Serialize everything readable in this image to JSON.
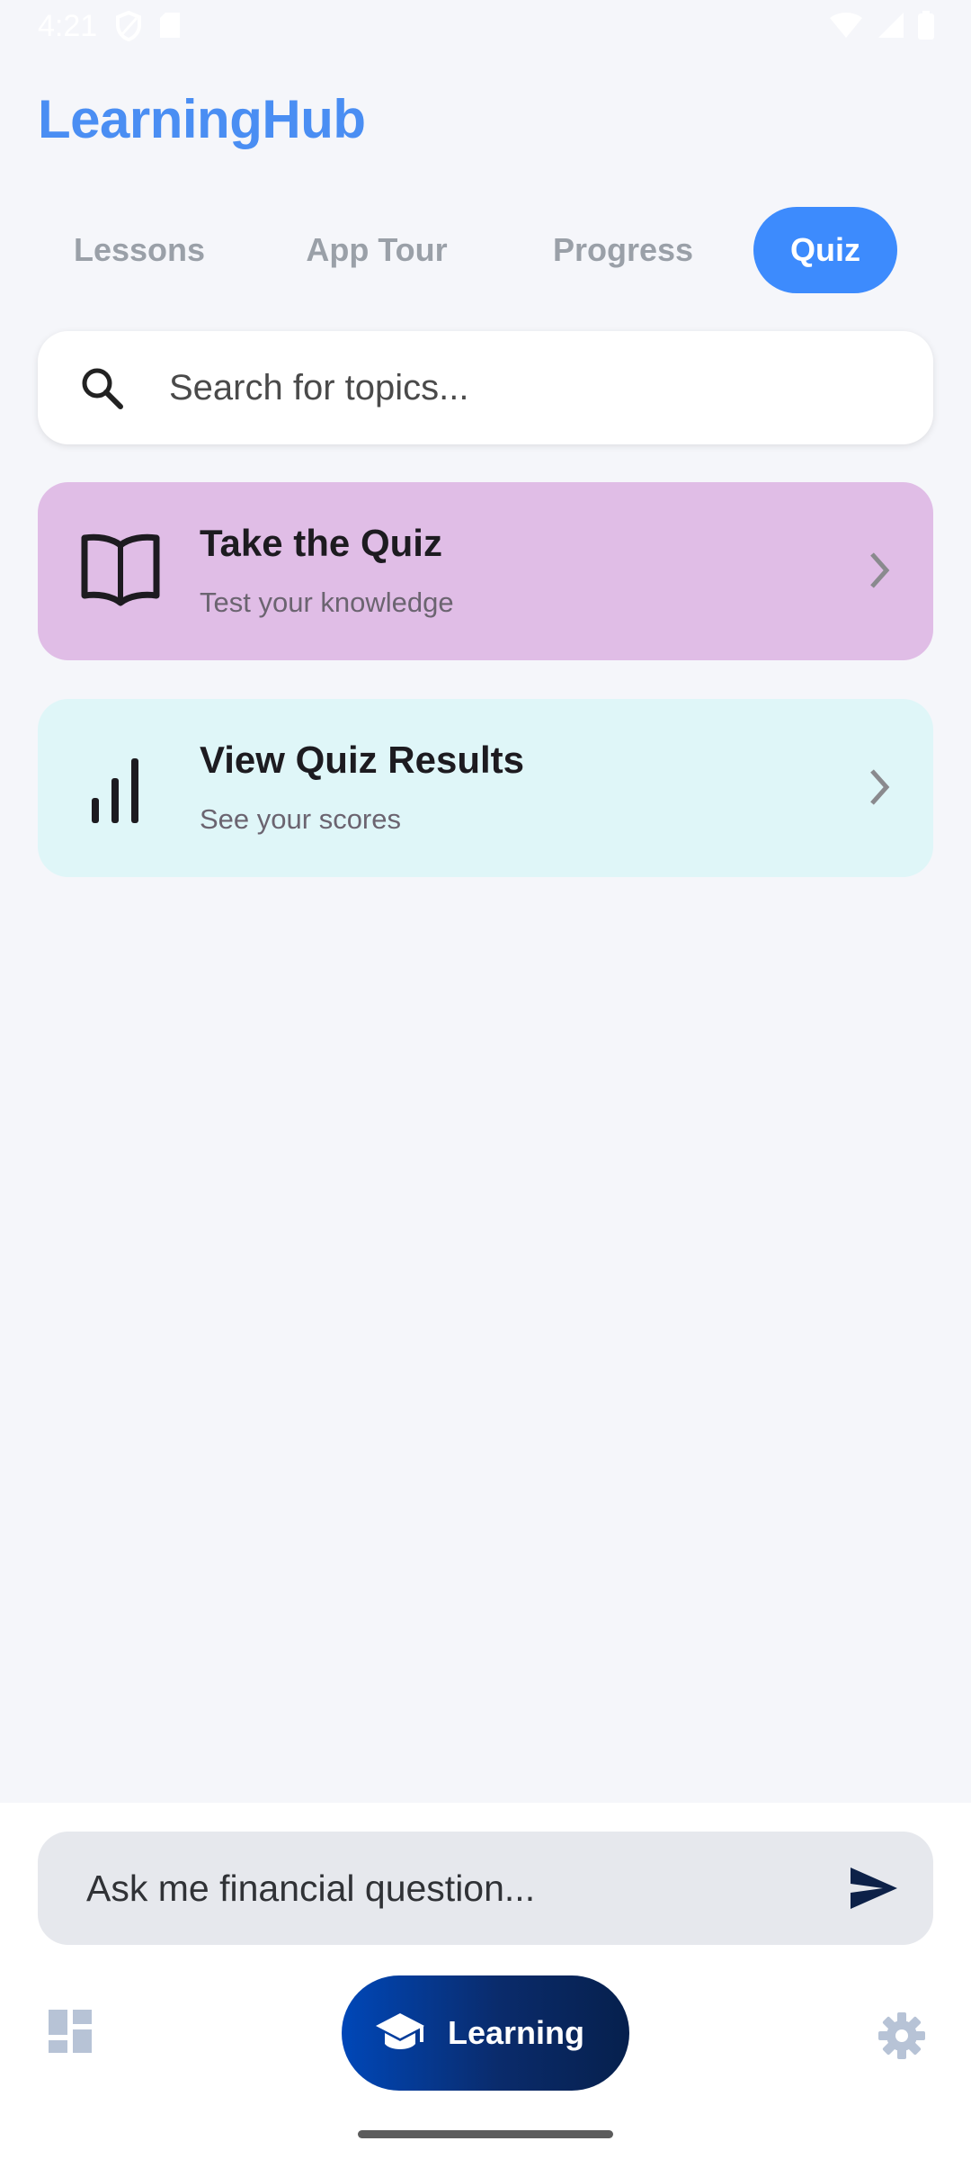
{
  "status_bar": {
    "time": "4:21",
    "icons": [
      "shield-icon",
      "sd-card-icon",
      "wifi-icon",
      "signal-icon",
      "battery-icon"
    ]
  },
  "app": {
    "title": "LearningHub",
    "accent_color": "#4a8ef3"
  },
  "tabs": [
    {
      "label": "Lessons",
      "active": false
    },
    {
      "label": "App Tour",
      "active": false
    },
    {
      "label": "Progress",
      "active": false
    },
    {
      "label": "Quiz",
      "active": true
    }
  ],
  "search": {
    "placeholder": "Search for topics...",
    "icon": "search-icon"
  },
  "cards": [
    {
      "title": "Take the Quiz",
      "subtitle": "Test your knowledge",
      "icon": "book-icon",
      "background": "#e0bde6"
    },
    {
      "title": "View Quiz Results",
      "subtitle": "See your scores",
      "icon": "bar-chart-icon",
      "background": "#dff6f8"
    }
  ],
  "chat": {
    "placeholder": "Ask me financial question...",
    "send_icon": "send-icon"
  },
  "bottom_nav": {
    "left_icon": "dashboard-icon",
    "center_label": "Learning",
    "center_icon": "graduation-cap-icon",
    "right_icon": "gear-icon"
  }
}
